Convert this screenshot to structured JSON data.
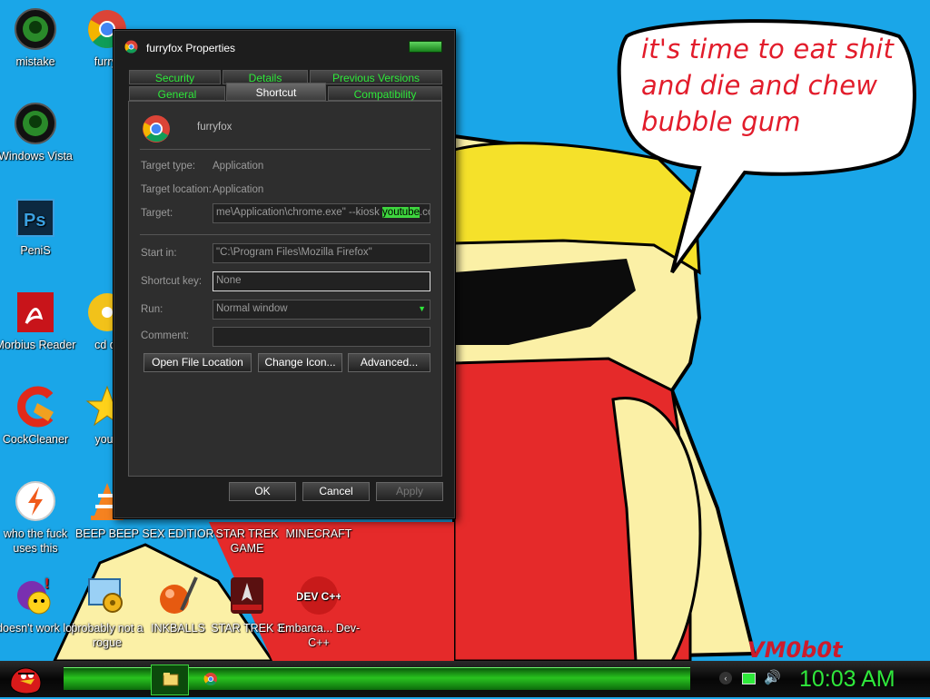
{
  "dialog": {
    "title": "furryfox Properties",
    "tabs_row1": [
      "Security",
      "Details",
      "Previous Versions"
    ],
    "tabs_row2": [
      "General",
      "Shortcut",
      "Compatibility"
    ],
    "active_tab": "Shortcut",
    "shortcut_name": "furryfox",
    "target_type_label": "Target type:",
    "target_type_value": "Application",
    "target_location_label": "Target location:",
    "target_location_value": "Application",
    "target_label": "Target:",
    "target_value_before": "me\\Application\\chrome.exe\" --kiosk ",
    "target_value_selected": "youtube",
    "target_value_after": ".com",
    "start_in_label": "Start in:",
    "start_in_value": "\"C:\\Program Files\\Mozilla Firefox\"",
    "shortcut_key_label": "Shortcut key:",
    "shortcut_key_value": "None",
    "run_label": "Run:",
    "run_value": "Normal window",
    "comment_label": "Comment:",
    "comment_value": "",
    "buttons": {
      "open_file_location": "Open File Location",
      "change_icon": "Change Icon...",
      "advanced": "Advanced..."
    },
    "ok": "OK",
    "cancel": "Cancel",
    "apply": "Apply"
  },
  "speech_bubble": {
    "line1": "it's time to eat shit",
    "line2": "and die and chew",
    "line3": "bubble gum"
  },
  "watermark": "VM0b0t",
  "desktop_icons": [
    {
      "label": "mistake",
      "icon": "green-orb-icon"
    },
    {
      "label": "furryf",
      "icon": "chrome-icon"
    },
    {
      "label": "Windows Vista",
      "icon": "green-orb-icon"
    },
    {
      "label": "PeniS",
      "icon": "photoshop-icon"
    },
    {
      "label": "Morbius Reader",
      "icon": "pdf-reader-icon"
    },
    {
      "label": "cd dr",
      "icon": "cd-drive-icon"
    },
    {
      "label": "CockCleaner",
      "icon": "ccleaner-icon"
    },
    {
      "label": "you t",
      "icon": "star-icon"
    },
    {
      "label": "who the fuck uses this",
      "icon": "flash-icon"
    },
    {
      "label": "BEEP BEEP",
      "icon": "vlc-icon"
    },
    {
      "label": "SEX EDITIOR",
      "icon": "paint-icon"
    },
    {
      "label": "STAR TREK GAME",
      "icon": "game-icon"
    },
    {
      "label": "MINECRAFT",
      "icon": "minecraft-icon"
    },
    {
      "label": "doesn't work lol",
      "icon": "yahoo-messenger-icon"
    },
    {
      "label": "probably not a rogue",
      "icon": "gears-icon"
    },
    {
      "label": "INKBALLS",
      "icon": "inkball-icon"
    },
    {
      "label": "STAR TREK 3",
      "icon": "star-trek-icon"
    },
    {
      "label": "Embarca... Dev-C++",
      "icon": "devcpp-icon"
    }
  ],
  "devcpp_icon_text": "DEV C++",
  "clock": "10:03 AM",
  "colors": {
    "accent": "#2ee83a",
    "bubble_text": "#e21c2b",
    "sky": "#1aa6e8"
  }
}
